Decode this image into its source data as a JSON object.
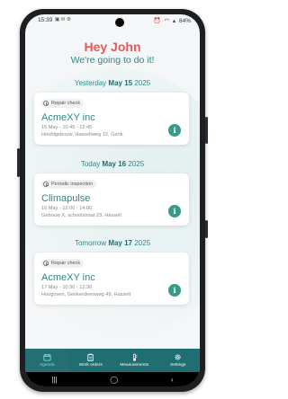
{
  "status": {
    "time": "15:39",
    "battery": "84%"
  },
  "header": {
    "greeting": "Hey John",
    "subtitle": "We're going to do it!"
  },
  "days": [
    {
      "prefix": "Yesterday",
      "day": "May 15",
      "year": "2025"
    },
    {
      "prefix": "Today",
      "day": "May 16",
      "year": "2025"
    },
    {
      "prefix": "Tomorrow",
      "day": "May 17",
      "year": "2025"
    }
  ],
  "appointments": [
    {
      "type": "Repair check",
      "company": "AcmeXY inc",
      "time": "15 May - 10:45 - 12:45",
      "address": "Hoofdgebouw, Hasseltweg 12, Genk"
    },
    {
      "type": "Periodic inspection",
      "company": "Climapulse",
      "time": "16 May - 12:00 - 14:00",
      "address": "Gebouw X, schoolstraat 23, Hasselt"
    },
    {
      "type": "Repair check",
      "company": "AcmeXY inc",
      "time": "17 May - 10:30 - 12:30",
      "address": "Hoogoven, Genkerdeenweg 49, Hasselt"
    }
  ],
  "tabs": [
    {
      "label": "Agenda",
      "icon": "calendar-icon"
    },
    {
      "label": "Work orders",
      "icon": "clipboard-icon"
    },
    {
      "label": "Measurements",
      "icon": "thermometer-icon"
    },
    {
      "label": "Settings",
      "icon": "gear-icon"
    }
  ],
  "info_label": "i",
  "colors": {
    "accent": "#2a8a87",
    "greeting": "#e25a5a",
    "tabbar": "#1f6f72",
    "info_button": "#3a9a8a"
  }
}
